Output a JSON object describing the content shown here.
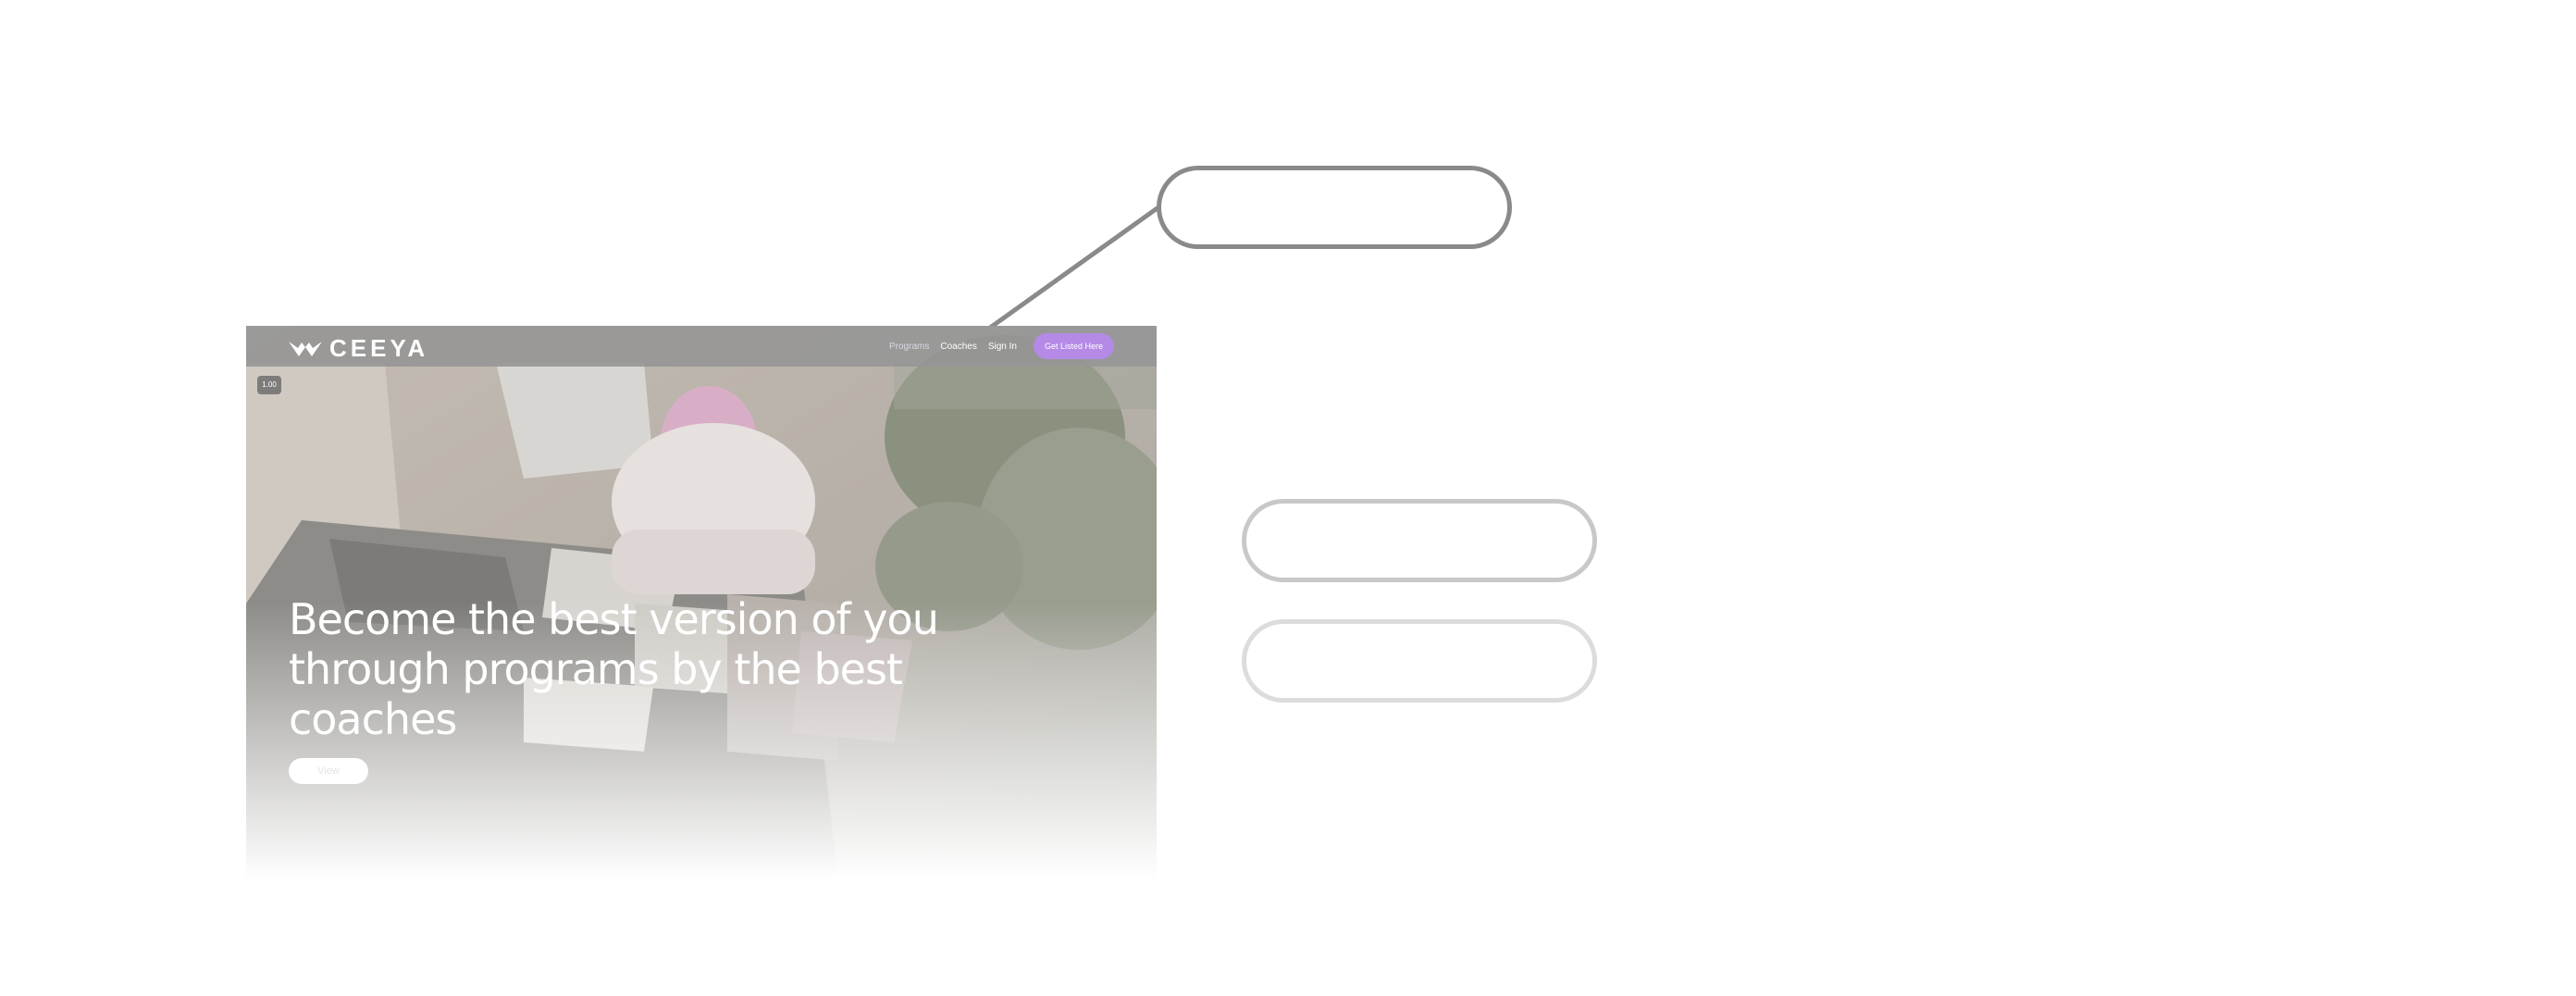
{
  "site": {
    "logo_text": "CEEYA",
    "nav": {
      "programs": "Programs",
      "coaches": "Coaches",
      "sign_in": "Sign In",
      "cta": "Get Listed Here"
    },
    "badge": "1.00",
    "hero": {
      "headline": "Become the best version of you through programs by the best coaches",
      "view_button": "View"
    },
    "colors": {
      "accent": "#b48ae6",
      "navbar": "#969696"
    }
  },
  "callouts": {
    "top": "",
    "middle": "",
    "bottom": ""
  }
}
